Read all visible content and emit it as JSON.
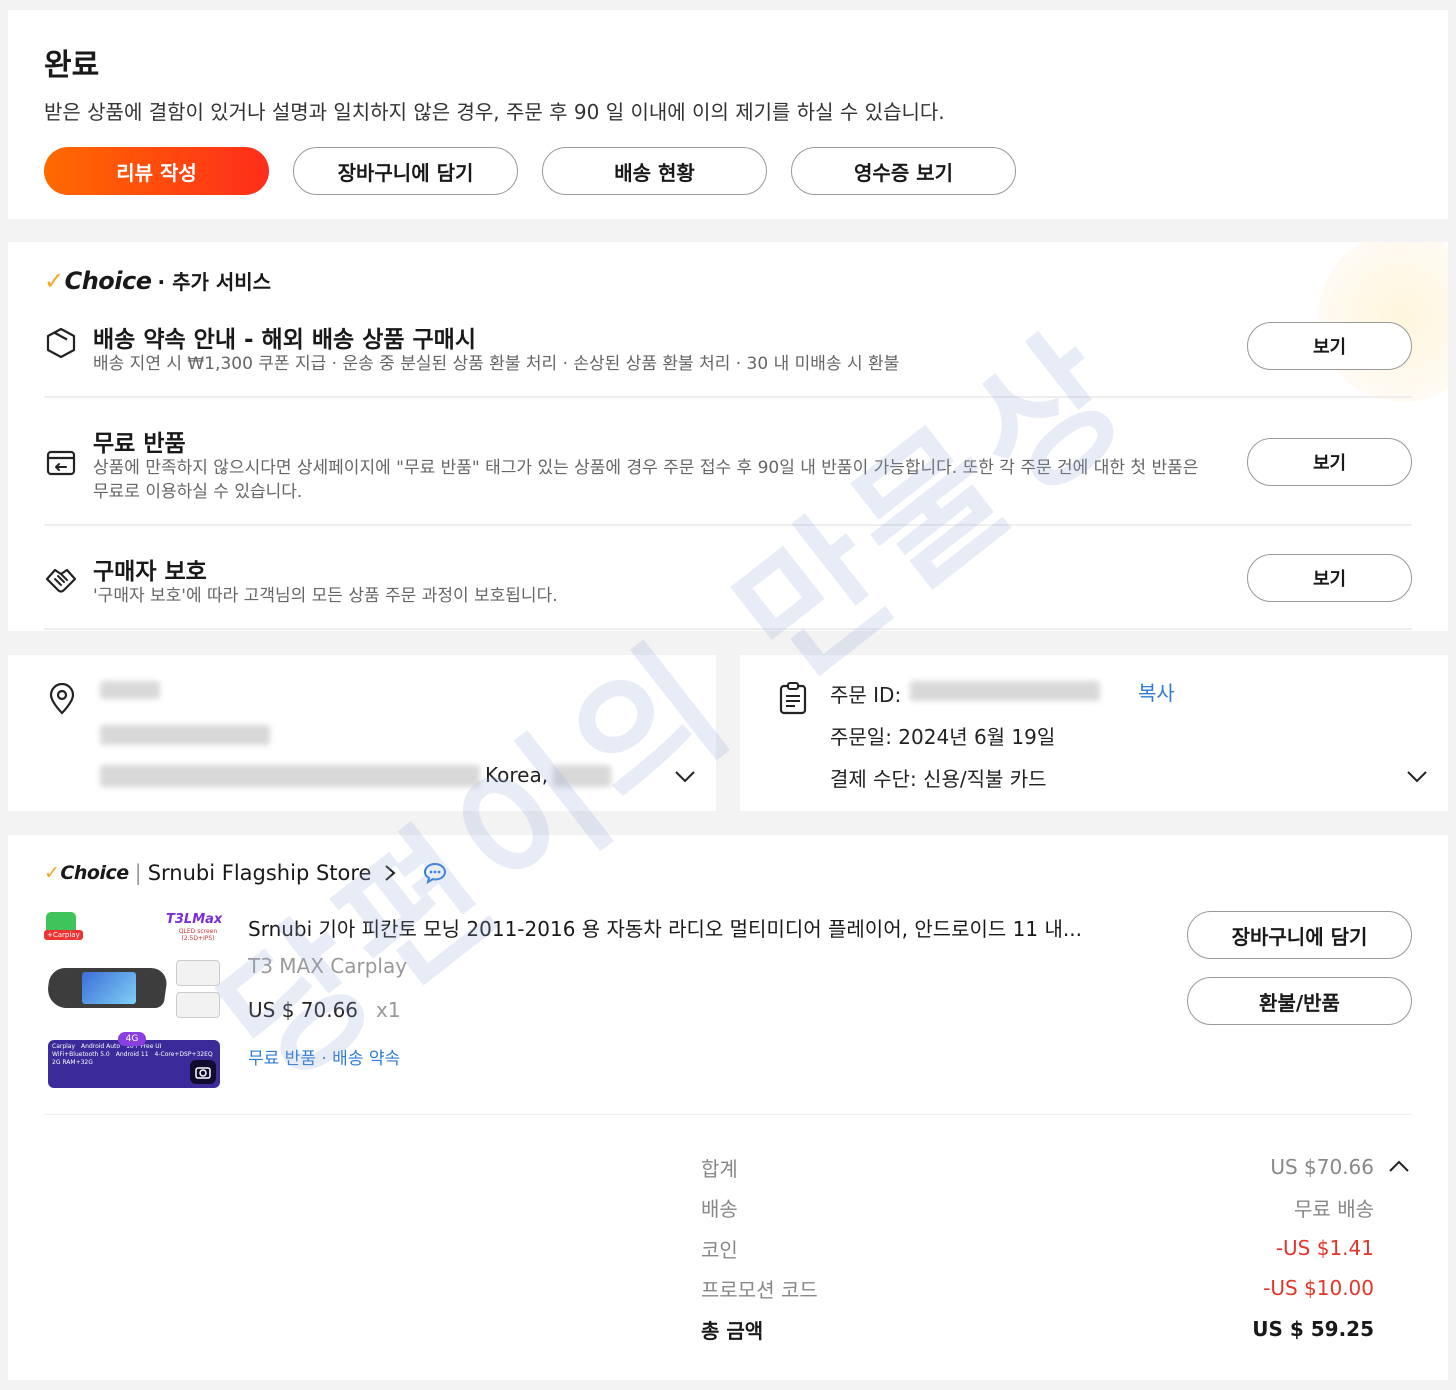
{
  "status": {
    "title": "완료",
    "description": "받은 상품에 결함이 있거나 설명과 일치하지 않은 경우, 주문 후 90 일 이내에 이의 제기를 하실 수 있습니다.",
    "buttons": [
      "리뷰 작성",
      "장바구니에 담기",
      "배송 현황",
      "영수증 보기"
    ]
  },
  "services": {
    "brand": "Choice",
    "subtitle": "· 추가 서비스",
    "items": [
      {
        "title": "배송 약속 안내 - 해외 배송 상품 구매시",
        "desc": "배송 지연 시 ₩1,300 쿠폰 지급 · 운송 중 분실된 상품 환불 처리 · 손상된 상품 환불 처리 · 30 내 미배송 시 환불",
        "button": "보기",
        "icon": "cube-icon"
      },
      {
        "title": "무료 반품",
        "desc": "상품에 만족하지 않으시다면 상세페이지에 \"무료 반품\" 태그가 있는 상품에 경우 주문 접수 후 90일 내 반품이 가능합니다. 또한 각 주문 건에 대한 첫 반품은 무료로 이용하실 수 있습니다.",
        "button": "보기",
        "icon": "return-box-icon"
      },
      {
        "title": "구매자 보호",
        "desc": "'구매자 보호'에 따라 고객님의 모든 상품 주문 과정이 보호됩니다.",
        "button": "보기",
        "icon": "handshake-icon"
      }
    ]
  },
  "address": {
    "country_fragment": "Korea,"
  },
  "order": {
    "id_label": "주문 ID:",
    "copy_label": "복사",
    "date_label": "주문일: 2024년 6월 19일",
    "payment_label": "결제 수단: 신용/직불 카드"
  },
  "product": {
    "brand": "Choice",
    "store_name": "Srnubi Flagship Store",
    "title": "Srnubi 기아 피칸토 모닝 2011-2016 용 자동차 라디오 멀티미디어 플레이어, 안드로이드 11 내...",
    "variant": "T3 MAX Carplay",
    "price": "US $ 70.66",
    "qty": "x1",
    "tags": "무료 반품 · 배송 약속",
    "buttons": {
      "add_cart": "장바구니에 담기",
      "refund": "환불/반품"
    },
    "thumb_texts": {
      "badge": "T3LMax",
      "badge_sub": "QLED screen (2.5D+IPS)",
      "features": [
        "Carplay",
        "Android Auto",
        "10+ Free UI",
        "WiFi+Bluetooth 5.0",
        "Android 11",
        "4-Core+DSP+32EQ",
        "2G RAM+32G"
      ],
      "tag_4g": "4G",
      "carplay_chip": "+Carplay"
    }
  },
  "summary": {
    "rows": [
      {
        "label": "합계",
        "value": "US $70.66"
      },
      {
        "label": "배송",
        "value": "무료 배송"
      },
      {
        "label": "코인",
        "value": "-US $1.41"
      },
      {
        "label": "프로모션 코드",
        "value": "-US $10.00"
      },
      {
        "label": "총 금액",
        "value": "US $ 59.25"
      }
    ]
  },
  "watermark": "당편이의 만물상",
  "colors": {
    "accent_start": "#ff6a00",
    "accent_end": "#ff2d1a",
    "link": "#2e7bd6",
    "discount": "#e4352b",
    "choice_check": "#f5a623"
  }
}
